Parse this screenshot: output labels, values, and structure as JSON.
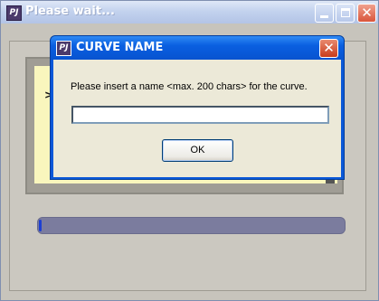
{
  "outer_window": {
    "title": "Please wait...",
    "icon_label": "PJ",
    "progress": 0.01
  },
  "dialog": {
    "title": "CURVE NAME",
    "icon_label": "PJ",
    "message": "Please insert a name <max. 200 chars> for the curve.",
    "input_value": "",
    "ok_label": "OK"
  },
  "background_text": {
    "arrow": ">"
  }
}
